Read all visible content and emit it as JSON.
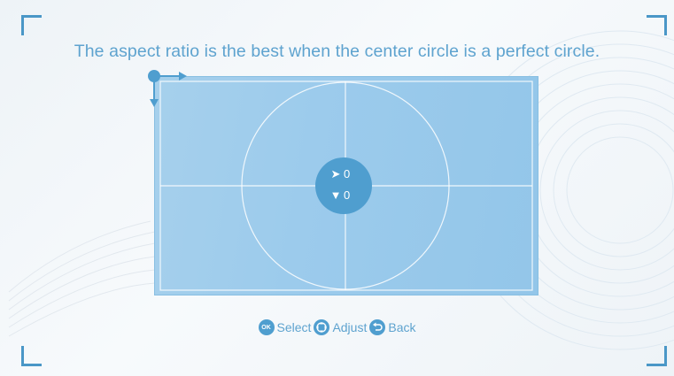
{
  "instruction": "The aspect ratio is the best when the center circle is a perfect circle.",
  "readout": {
    "horizontal_icon": "arrow-right-icon",
    "horizontal_value": "0",
    "vertical_icon": "arrow-down-icon",
    "vertical_value": "0"
  },
  "footer": {
    "ok_icon_text": "OK",
    "select_label": "Select",
    "adjust_label": "Adjust",
    "back_label": "Back"
  },
  "colors": {
    "accent": "#4f9ecf",
    "text": "#5ea3cf",
    "pattern_fill": "#9ccbec"
  }
}
